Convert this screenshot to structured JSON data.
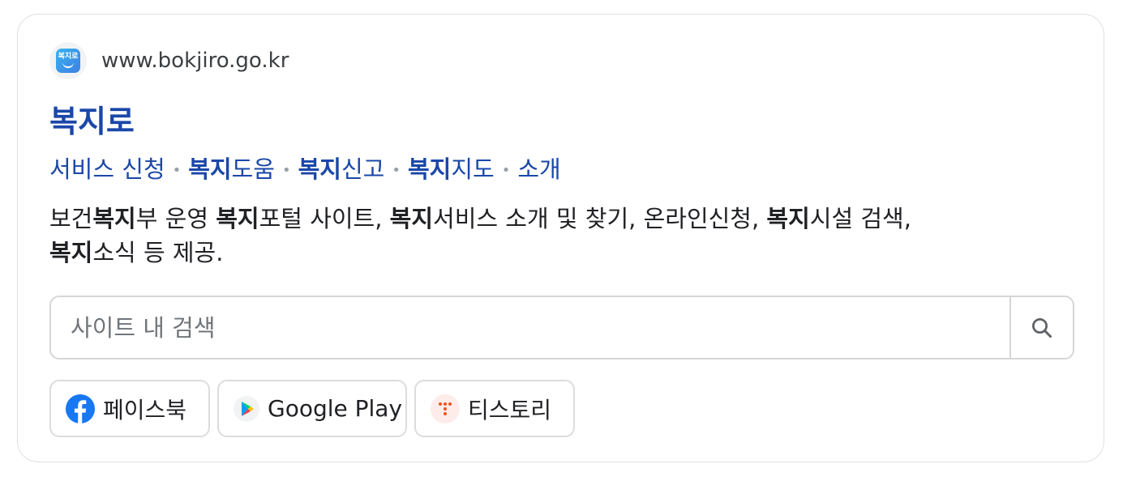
{
  "result": {
    "url": "www.bokjiro.go.kr",
    "favicon_text": "복지로",
    "title": "복지로",
    "sitelinks": [
      {
        "bold": "",
        "rest": "서비스 신청"
      },
      {
        "bold": "복지",
        "rest": "도움"
      },
      {
        "bold": "복지",
        "rest": "신고"
      },
      {
        "bold": "복지",
        "rest": "지도"
      },
      {
        "bold": "",
        "rest": "소개"
      }
    ],
    "description": {
      "p1": "보건",
      "b1": "복지",
      "p2": "부 운영 ",
      "b2": "복지",
      "p3": "포털 사이트, ",
      "b3": "복지",
      "p4": "서비스 소개 및 찾기, 온라인신청, ",
      "b4": "복지",
      "p5": "시설 검색,",
      "b5": "복지",
      "p6": "소식 등 제공."
    },
    "search": {
      "placeholder": "사이트 내 검색",
      "value": ""
    },
    "chips": [
      {
        "label": "페이스북",
        "icon": "facebook-icon"
      },
      {
        "label": "Google Play",
        "icon": "google-play-icon"
      },
      {
        "label": "티스토리",
        "icon": "tistory-icon"
      }
    ]
  },
  "colors": {
    "link": "#1a47a8",
    "facebook": "#1877f2",
    "tistory": "#eb531f"
  }
}
